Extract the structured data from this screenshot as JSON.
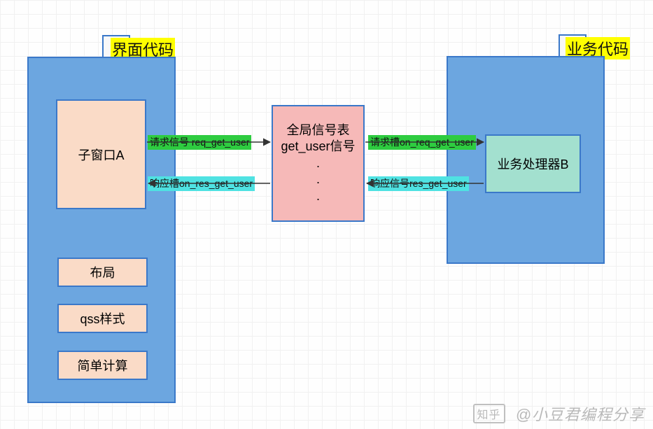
{
  "left_group": {
    "header": "界面代码",
    "child_window": "子窗口A",
    "sub_layout": "布局",
    "sub_qss": "qss样式",
    "sub_calc": "简单计算"
  },
  "right_group": {
    "header": "业务代码",
    "handler": "业务处理器B"
  },
  "center": {
    "title_line1": "全局信号表",
    "title_line2": "get_user信号",
    "dots": "..."
  },
  "connectors": {
    "req_left": "请求信号 req_get_user",
    "res_left": "响应槽on_res_get_user",
    "req_right": "请求槽on_req_get_user",
    "res_right": "响应信号res_get_user"
  },
  "watermark": {
    "site": "知乎",
    "author": "@小豆君编程分享"
  },
  "colors": {
    "container_fill": "#6ca6e0",
    "border": "#3a78c9",
    "peach": "#fadbc7",
    "pink": "#f6b9b8",
    "mint": "#a3e0cf",
    "green": "#2ecc40",
    "cyan": "#4fe2e2",
    "highlight": "#ffff00"
  }
}
